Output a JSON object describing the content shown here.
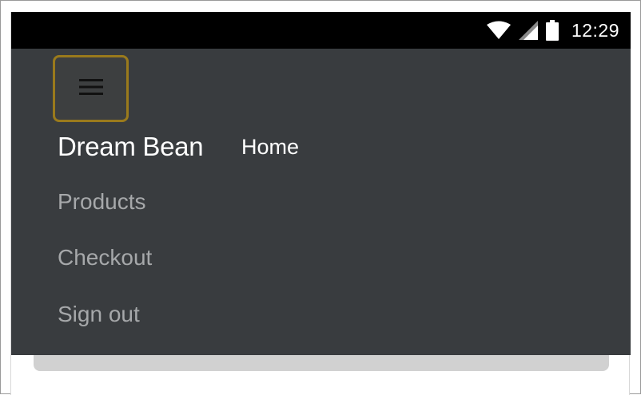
{
  "status_bar": {
    "time": "12:29",
    "icons": [
      "wifi-icon",
      "cellular-signal-icon",
      "battery-icon"
    ]
  },
  "navbar": {
    "toggle_icon": "hamburger-menu-icon",
    "brand": "Dream Bean",
    "active_link": "Home",
    "links": [
      "Products",
      "Checkout",
      "Sign out"
    ]
  },
  "colors": {
    "navbar_bg": "#393c3f",
    "toggle_focus_ring": "#9a7a1c",
    "link_muted": "#a6a8aa",
    "link_active": "#ffffff"
  }
}
